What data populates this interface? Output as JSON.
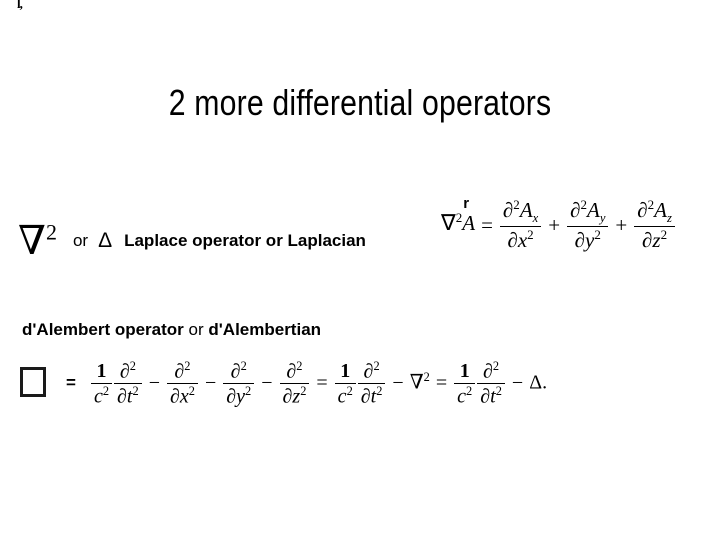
{
  "slide": {
    "title": "2 more differential operators",
    "background_color": "#ffffff",
    "text_color": "#000000",
    "stray_glyph": "l,"
  },
  "laplace": {
    "nabla": "∇",
    "nabla_exponent": "2",
    "or_word": "or",
    "delta_symbol": "Δ",
    "label": "Laplace operator or Laplacian",
    "equation": {
      "lhs_nabla": "∇",
      "lhs_exponent": "2",
      "lhs_vector": "A",
      "vector_arrow": "r",
      "equals": "=",
      "terms": [
        {
          "numerator_partial": "∂",
          "numerator_exponent": "2",
          "numerator_symbol": "A",
          "numerator_subscript": "x",
          "denominator_partial": "∂",
          "denominator_variable": "x",
          "denominator_exponent": "2",
          "operator_after": "+"
        },
        {
          "numerator_partial": "∂",
          "numerator_exponent": "2",
          "numerator_symbol": "A",
          "numerator_subscript": "y",
          "denominator_partial": "∂",
          "denominator_variable": "y",
          "denominator_exponent": "2",
          "operator_after": "+"
        },
        {
          "numerator_partial": "∂",
          "numerator_exponent": "2",
          "numerator_symbol": "A",
          "numerator_subscript": "z",
          "denominator_partial": "∂",
          "denominator_variable": "z",
          "denominator_exponent": "2",
          "operator_after": ""
        }
      ]
    }
  },
  "dalembert": {
    "label_bold_1": "d'Alembert operator",
    "label_or": " or ",
    "label_bold_2": "d'Alembertian",
    "box_symbol": "□",
    "equals": "=",
    "equation": {
      "c_fraction": {
        "num": "1",
        "den_var": "c",
        "den_exp": "2"
      },
      "t_fraction": {
        "num_partial": "∂",
        "num_exp": "2",
        "den_partial": "∂",
        "den_var": "t",
        "den_exp": "2"
      },
      "minus": "−",
      "x_fraction": {
        "num_partial": "∂",
        "num_exp": "2",
        "den_partial": "∂",
        "den_var": "x",
        "den_exp": "2"
      },
      "y_fraction": {
        "num_partial": "∂",
        "num_exp": "2",
        "den_partial": "∂",
        "den_var": "y",
        "den_exp": "2"
      },
      "z_fraction": {
        "num_partial": "∂",
        "num_exp": "2",
        "den_partial": "∂",
        "den_var": "z",
        "den_exp": "2"
      },
      "equals_2": "=",
      "nabla": "∇",
      "nabla_exp": "2",
      "equals_3": "=",
      "delta": "Δ",
      "period": "."
    }
  }
}
